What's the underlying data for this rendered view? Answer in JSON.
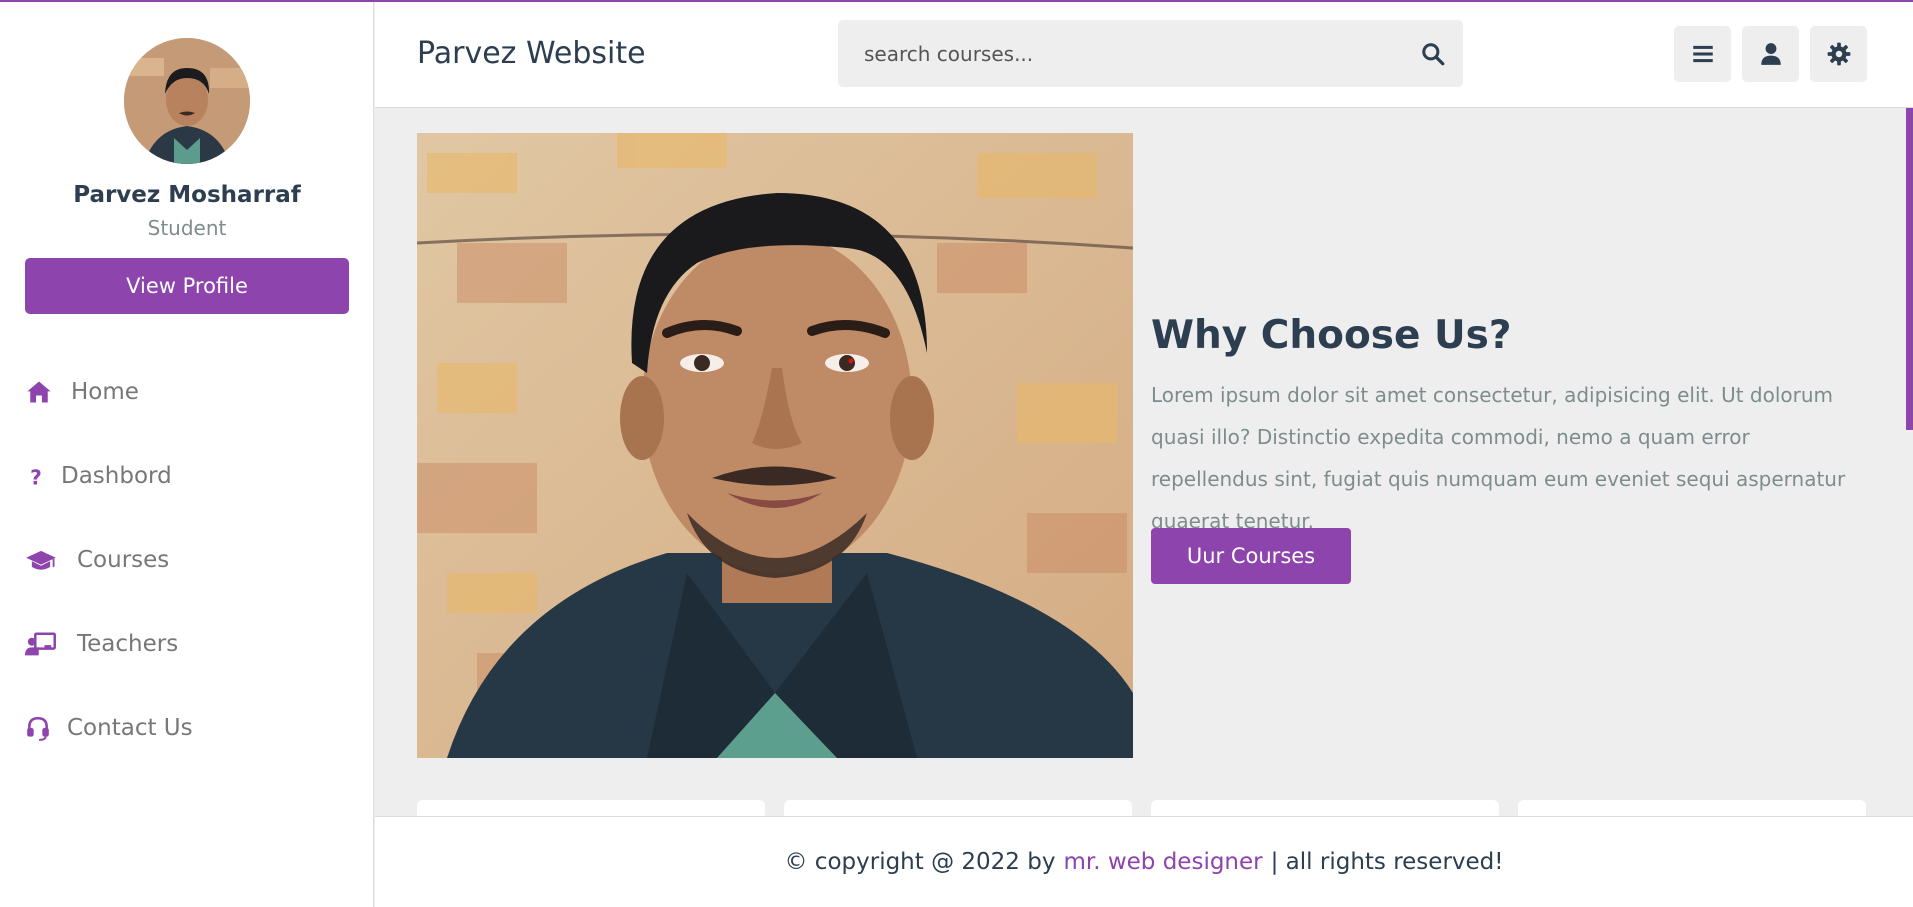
{
  "sidebar": {
    "profile": {
      "name": "Parvez Mosharraf",
      "role": "Student",
      "view_profile_label": "View Profile"
    },
    "nav": [
      {
        "label": "Home",
        "icon": "home-icon"
      },
      {
        "label": "Dashbord",
        "icon": "question-icon"
      },
      {
        "label": "Courses",
        "icon": "graduation-cap-icon"
      },
      {
        "label": "Teachers",
        "icon": "chalkboard-teacher-icon"
      },
      {
        "label": "Contact Us",
        "icon": "headset-icon"
      }
    ]
  },
  "header": {
    "title": "Parvez Website",
    "search": {
      "placeholder": "search courses..."
    },
    "buttons": [
      "menu-icon",
      "user-icon",
      "settings-icon"
    ]
  },
  "main": {
    "heading": "Why Choose Us?",
    "text": "Lorem ipsum dolor sit amet consectetur, adipisicing elit. Ut dolorum quasi illo? Distinctio expedita commodi, nemo a quam error repellendus sint, fugiat quis numquam eum eveniet sequi aspernatur quaerat tenetur.",
    "cta_label": "Uur Courses"
  },
  "footer": {
    "prefix": "© copyright @ 2022 by",
    "link": "mr. web designer",
    "suffix": "| all rights reserved!"
  },
  "colors": {
    "accent": "#8e44ad",
    "text": "#2c3e50",
    "muted": "#7f8c8d",
    "background": "#eeeeee"
  }
}
